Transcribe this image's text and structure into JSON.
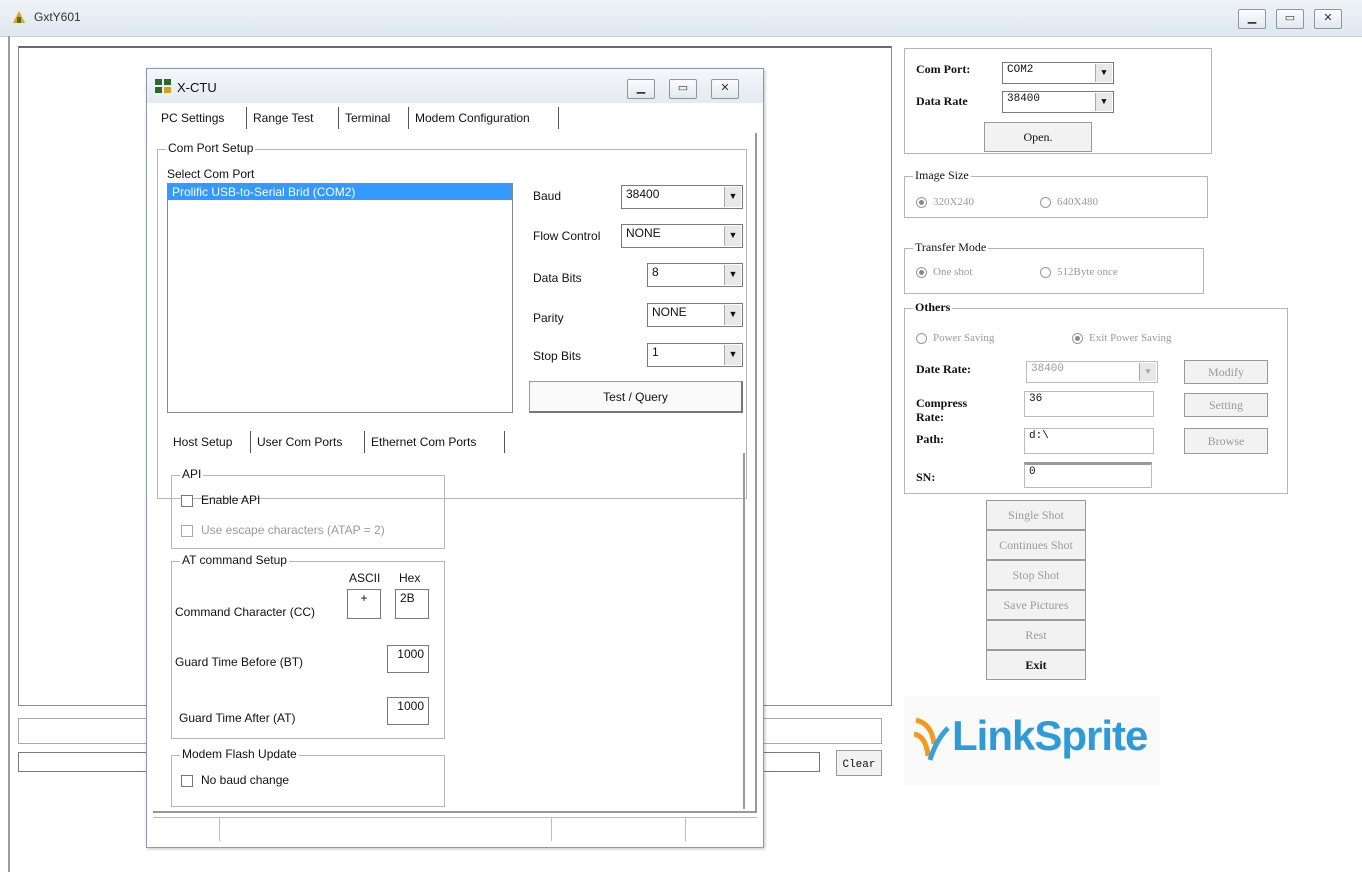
{
  "outer": {
    "title": "GxtY601",
    "clear_label": "Clear",
    "com_port_label": "Com Port:",
    "com_port_value": "COM2",
    "data_rate_label": "Data Rate",
    "data_rate_value": "38400",
    "open_label": "Open.",
    "image_size": {
      "legend": "Image Size",
      "opt1": "320X240",
      "opt2": "640X480"
    },
    "transfer_mode": {
      "legend": "Transfer Mode",
      "opt1": "One shot",
      "opt2": "512Byte once"
    },
    "others": {
      "legend": "Others",
      "power_saving": "Power Saving",
      "exit_power_saving": "Exit Power Saving",
      "date_rate_label": "Date Rate:",
      "date_rate_value": "38400",
      "modify_label": "Modify",
      "compress_label": "Compress",
      "rate_label": "Rate:",
      "compress_value": "36",
      "setting_label": "Setting",
      "path_label": "Path:",
      "path_value": "d:\\",
      "browse_label": "Browse",
      "sn_label": "SN:",
      "sn_value": "0"
    },
    "actions": [
      "Single Shot",
      "Continues Shot",
      "Stop Shot",
      "Save Pictures",
      "Rest",
      "Exit"
    ],
    "logo_text": "LinkSprite"
  },
  "xctu": {
    "title": "X-CTU",
    "tabs": [
      "PC Settings",
      "Range Test",
      "Terminal",
      "Modem Configuration"
    ],
    "com_port_setup_legend": "Com Port Setup",
    "select_com_port_label": "Select Com Port",
    "port_item": "Prolific USB-to-Serial Brid (COM2)",
    "baud_label": "Baud",
    "baud_value": "38400",
    "flow_label": "Flow Control",
    "flow_value": "NONE",
    "databits_label": "Data Bits",
    "databits_value": "8",
    "parity_label": "Parity",
    "parity_value": "NONE",
    "stopbits_label": "Stop Bits",
    "stopbits_value": "1",
    "test_label": "Test / Query",
    "subtabs": [
      "Host Setup",
      "User Com Ports",
      "Ethernet Com Ports"
    ],
    "api_legend": "API",
    "enable_api": "Enable API",
    "escape_chars": "Use escape characters (ATAP = 2)",
    "at_legend": "AT command Setup",
    "ascii_label": "ASCII",
    "hex_label": "Hex",
    "cc_label": "Command Character (CC)",
    "cc_ascii": "+",
    "cc_hex": "2B",
    "bt_label": "Guard Time Before (BT)",
    "bt_value": "1000",
    "at_label": "Guard Time After (AT)",
    "at_value": "1000",
    "flash_legend": "Modem Flash Update",
    "no_baud": "No baud change"
  }
}
